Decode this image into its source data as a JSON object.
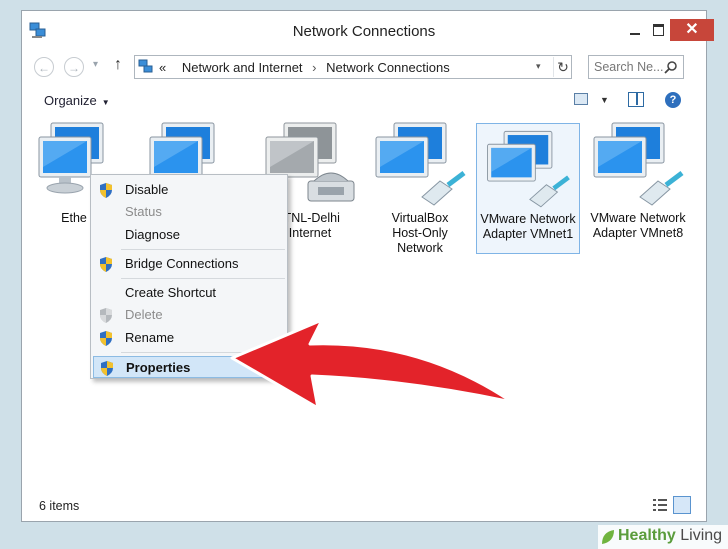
{
  "window": {
    "title": "Network Connections"
  },
  "nav": {
    "back": "←",
    "forward": "→",
    "up": "↑",
    "refresh": "↻",
    "breadcrumb_prefix": "«",
    "breadcrumbs": [
      "Network and Internet",
      "Network Connections"
    ],
    "search_placeholder": "Search Ne..."
  },
  "toolbar": {
    "organize": "Organize",
    "help": "?"
  },
  "items": [
    {
      "label": "Ethe",
      "icon": "network-monitor-icon"
    },
    {
      "label": "",
      "icon": "network-monitor-icon"
    },
    {
      "label": "ITNL-Delhi\nInternet",
      "icon": "dialup-modem-icon"
    },
    {
      "label": "VirtualBox\nHost-Only\nNetwork",
      "icon": "network-adapter-icon"
    },
    {
      "label": "VMware Network\nAdapter VMnet1",
      "icon": "network-adapter-icon",
      "selected": true
    },
    {
      "label": "VMware Network\nAdapter VMnet8",
      "icon": "network-adapter-icon"
    }
  ],
  "context_menu": {
    "items": [
      {
        "label": "Disable",
        "shield": true,
        "enabled": true
      },
      {
        "label": "Status",
        "shield": false,
        "enabled": false
      },
      {
        "label": "Diagnose",
        "shield": false,
        "enabled": true
      },
      {
        "label": "Bridge Connections",
        "shield": true,
        "enabled": true
      },
      {
        "label": "Create Shortcut",
        "shield": false,
        "enabled": true
      },
      {
        "label": "Delete",
        "shield": true,
        "enabled": false
      },
      {
        "label": "Rename",
        "shield": true,
        "enabled": true
      },
      {
        "label": "Properties",
        "shield": true,
        "enabled": true,
        "highlighted": true
      }
    ]
  },
  "status": {
    "items_count": "6 items"
  },
  "watermark": {
    "prefix": "Healthy",
    "suffix": "Living"
  },
  "colors": {
    "arrow": "#e3232a",
    "close_button": "#c7463a",
    "selection": "#7fb4e6"
  }
}
